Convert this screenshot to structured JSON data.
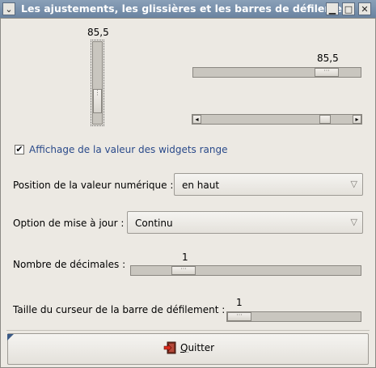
{
  "window": {
    "title": "Les ajustements, les glissières et les barres de défilement"
  },
  "vscale": {
    "value_label": "85,5",
    "value_fraction": 0.855
  },
  "hscale": {
    "value_label": "85,5",
    "value_fraction": 0.855
  },
  "hscrollbar": {
    "value_fraction": 0.855,
    "left_arrow": "◂",
    "right_arrow": "▸"
  },
  "checkbox": {
    "label": "Affichage de la valeur des widgets range",
    "checked": true,
    "mark": "✔"
  },
  "value_position": {
    "label": "Position de la valeur numérique :",
    "selected": "en haut"
  },
  "update_option": {
    "label": "Option de mise à jour :",
    "selected": "Continu"
  },
  "decimals": {
    "label": "Nombre de décimales :",
    "value_label": "1"
  },
  "scroll_size": {
    "label": "Taille du curseur de la barre de défilement :",
    "value_label": "1"
  },
  "quit_button": {
    "label": "Quitter"
  },
  "icons": {
    "menu": "chevron-down-icon",
    "minimize": "minimize-icon",
    "maximize": "maximize-icon",
    "close": "close-icon",
    "dropdown": "triangle-down-icon",
    "quit": "exit-icon"
  }
}
